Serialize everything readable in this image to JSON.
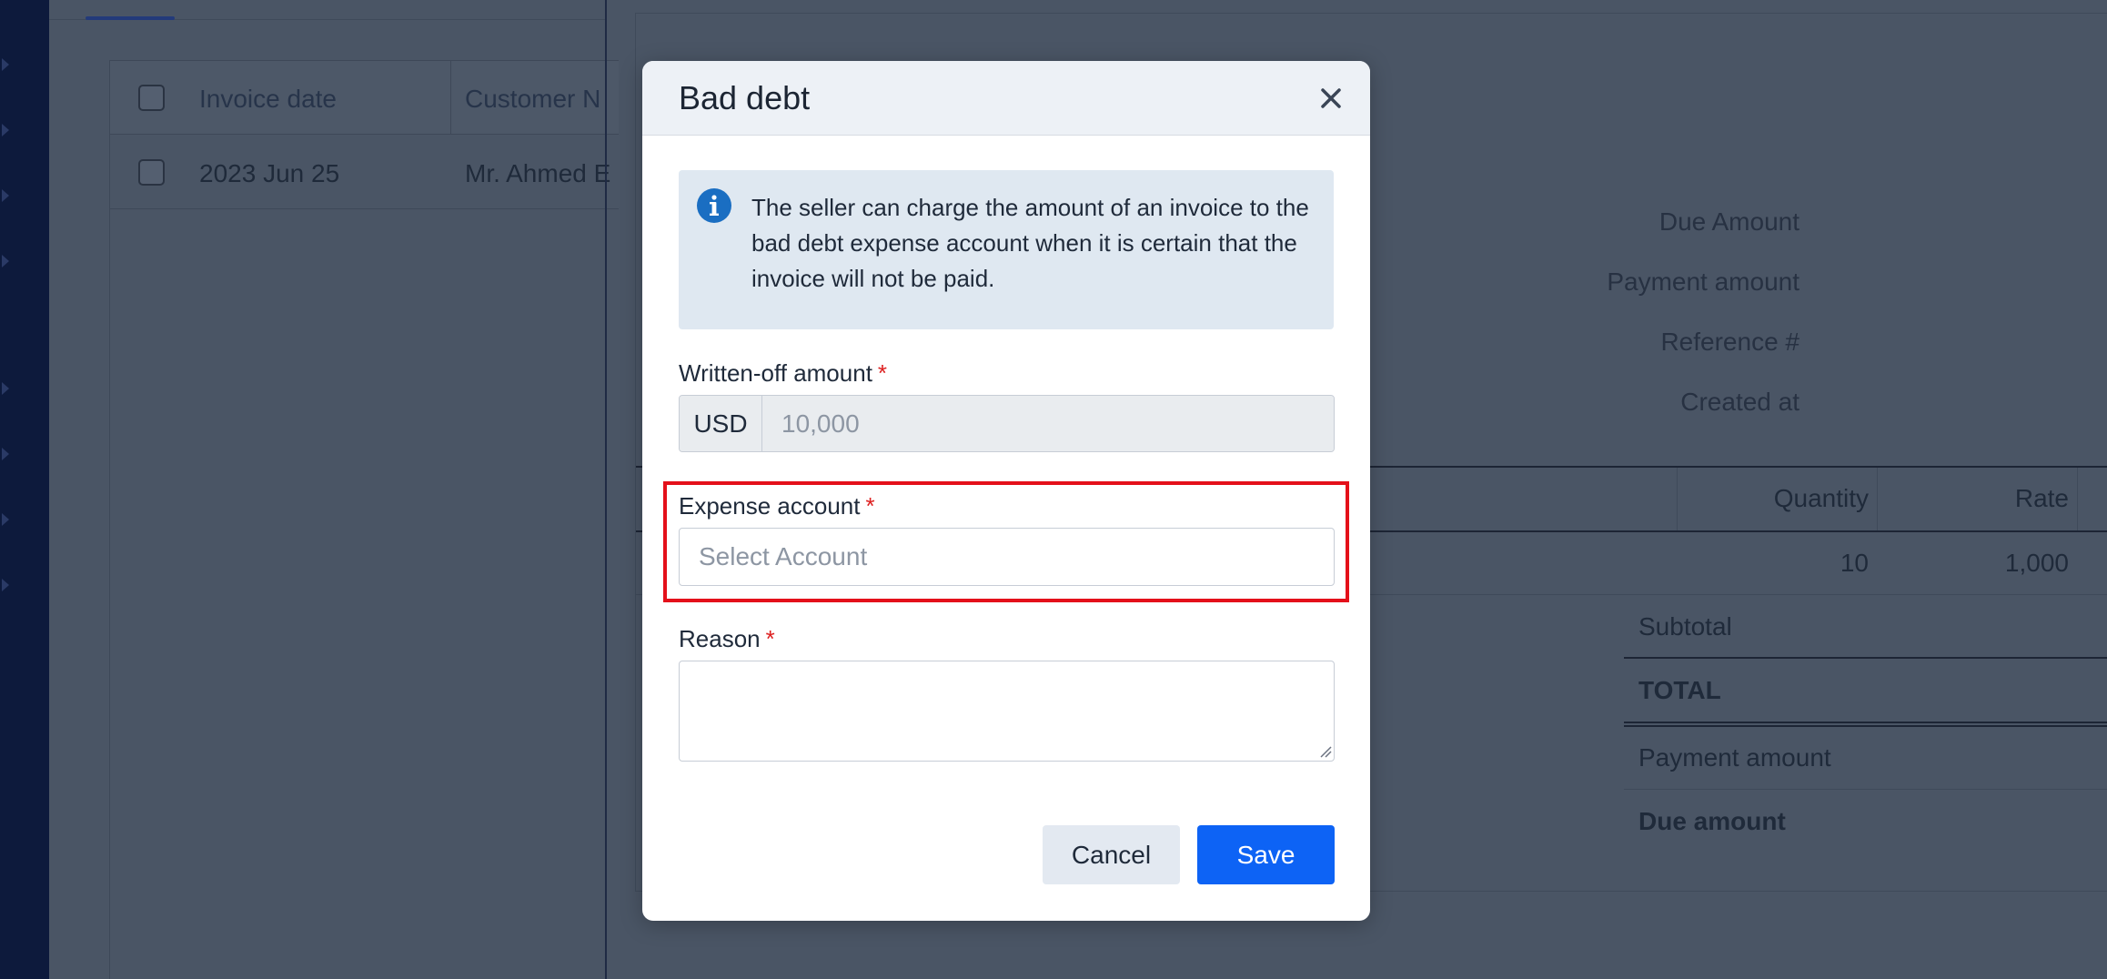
{
  "list": {
    "headers": [
      "Invoice date",
      "Customer N"
    ],
    "rows": [
      {
        "date": "2023 Jun 25",
        "customer": "Mr. Ahmed E"
      }
    ]
  },
  "detail": {
    "labels": [
      "Due Amount",
      "Payment amount",
      "Reference #",
      "Created at"
    ],
    "columns": {
      "quantity": "Quantity",
      "rate": "Rate"
    },
    "item": {
      "quantity": "10",
      "rate": "1,000"
    },
    "totals": {
      "subtotal": "Subtotal",
      "total": "TOTAL",
      "payment_amount": "Payment amount",
      "due_amount": "Due amount"
    }
  },
  "modal": {
    "title": "Bad debt",
    "info_text": "The seller can charge the amount of an invoice to the bad debt expense account when it is certain that the invoice will not be paid.",
    "written_off": {
      "label": "Written-off amount",
      "required_mark": "*",
      "currency": "USD",
      "value": "10,000"
    },
    "expense_account": {
      "label": "Expense account",
      "required_mark": "*",
      "placeholder": "Select Account"
    },
    "reason": {
      "label": "Reason",
      "required_mark": "*",
      "value": ""
    },
    "buttons": {
      "cancel": "Cancel",
      "save": "Save"
    }
  },
  "colors": {
    "primary": "#0d63f5",
    "required": "#dd1f1f",
    "highlight": "#e4101a",
    "info_bg": "#dfe8f1",
    "info_icon": "#1a6ec2"
  }
}
